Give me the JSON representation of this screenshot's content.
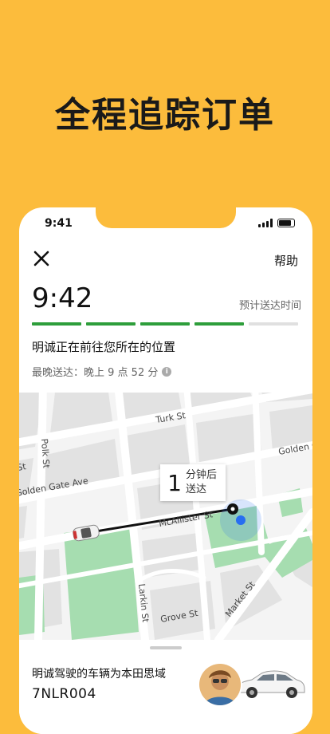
{
  "promo": {
    "title": "全程追踪订单"
  },
  "status_bar": {
    "time": "9:41"
  },
  "header": {
    "help_label": "帮助"
  },
  "trip": {
    "eta_time": "9:42",
    "eta_label": "预计送达时间",
    "progress": {
      "completed_segments": 4,
      "total_segments": 5
    },
    "status_text": "明诚正在前往您所在的位置",
    "latest_delivery": "最晚送达：晚上 9 点 52 分",
    "info_icon": "i"
  },
  "map": {
    "streets": [
      "Turk St",
      "Polk St",
      "Golden Gate Ave",
      "McAllister St",
      "Golden G",
      "Larkin St",
      "Grove St",
      "Market St",
      "St"
    ],
    "eta_bubble": {
      "number": "1",
      "line1": "分钟后",
      "line2": "送达"
    }
  },
  "driver": {
    "vehicle_text": "明诚驾驶的车辆为本田思域",
    "plate": "7NLR004"
  },
  "colors": {
    "background": "#FCBC3C",
    "progress_done": "#2E9E3B",
    "progress_pending": "#E0E0E0",
    "park": "#A6DDB0",
    "map_block": "#E2E2E2",
    "location_blue": "#276EF1"
  },
  "icons": [
    "close-icon",
    "signal-icon",
    "battery-icon",
    "info-icon",
    "car-icon",
    "destination-pin-icon",
    "user-location-icon"
  ]
}
